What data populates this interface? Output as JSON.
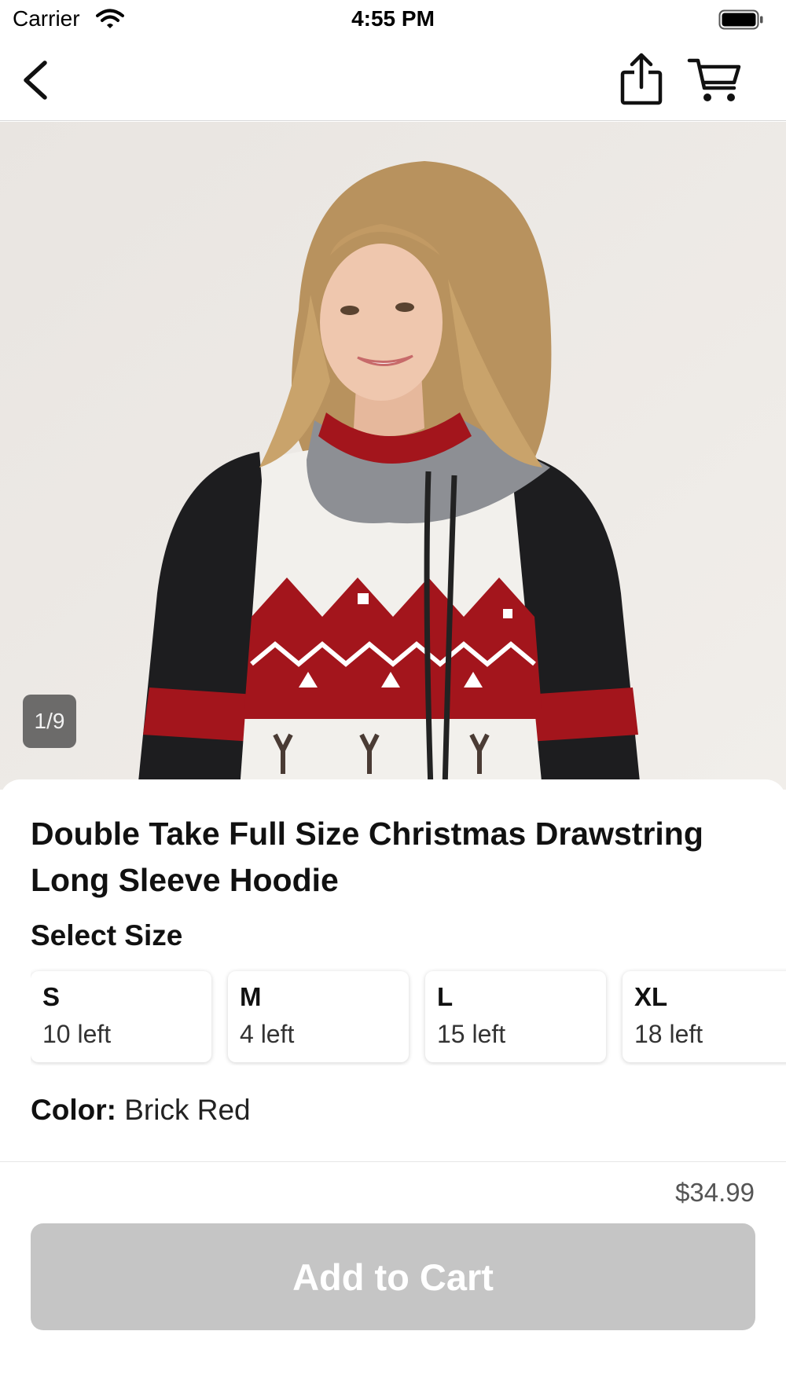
{
  "status_bar": {
    "carrier": "Carrier",
    "time": "4:55 PM",
    "icons": [
      "wifi-icon",
      "battery-icon"
    ]
  },
  "navbar": {
    "icons": [
      "back-chevron-icon",
      "share-icon",
      "cart-icon"
    ]
  },
  "gallery": {
    "counter": "1/9",
    "current_index": 1,
    "total": 9
  },
  "product": {
    "title": "Double Take Full Size Christmas Drawstring Long Sleeve Hoodie",
    "select_size_label": "Select Size",
    "sizes": [
      {
        "name": "S",
        "stock": "10 left"
      },
      {
        "name": "M",
        "stock": "4 left"
      },
      {
        "name": "L",
        "stock": "15 left"
      },
      {
        "name": "XL",
        "stock": "18 left"
      }
    ],
    "color_label": "Color:",
    "color_value": "Brick Red"
  },
  "bottom_bar": {
    "price": "$34.99",
    "add_to_cart_label": "Add to Cart",
    "add_to_cart_color": "#c5c5c5"
  },
  "colors": {
    "hoodie_red": "#a3151c",
    "hoodie_black": "#1d1d1f",
    "hoodie_white": "#f2f0ec",
    "background": "#ece8e4"
  }
}
